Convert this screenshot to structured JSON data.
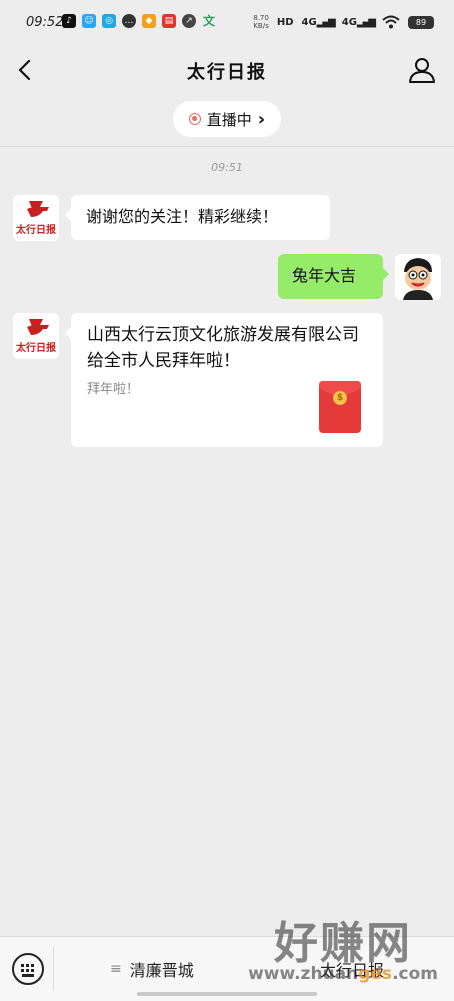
{
  "status_bar": {
    "time": "09:52",
    "net_speed_value": "8.70",
    "net_speed_unit": "KB/s",
    "hd_label": "HD",
    "sim1": "4G",
    "sim2": "4G",
    "battery": "89"
  },
  "nav": {
    "title": "太行日报",
    "back_icon": "chevron-left-icon",
    "profile_icon": "person-icon"
  },
  "live": {
    "label": "直播中",
    "chevron": "›",
    "accent": "#f06a5e"
  },
  "messages": {
    "timestamp": "09:51",
    "msg1": "谢谢您的关注！精彩继续！",
    "msg2": "兔年大吉",
    "msg3_title": "山西太行云顶文化旅游发展有限公司给全市人民拜年啦！",
    "msg3_sub": "拜年啦！"
  },
  "bottom": {
    "menu1": "清廉晋城",
    "menu2": "太行日报"
  },
  "watermark": {
    "big": "好赚网",
    "url_a": "www.zhuan",
    "url_b": "ges",
    "url_c": ".com"
  },
  "colors": {
    "background": "#ededed",
    "self_bubble": "#95ec69",
    "red_packet": "#e33939"
  }
}
